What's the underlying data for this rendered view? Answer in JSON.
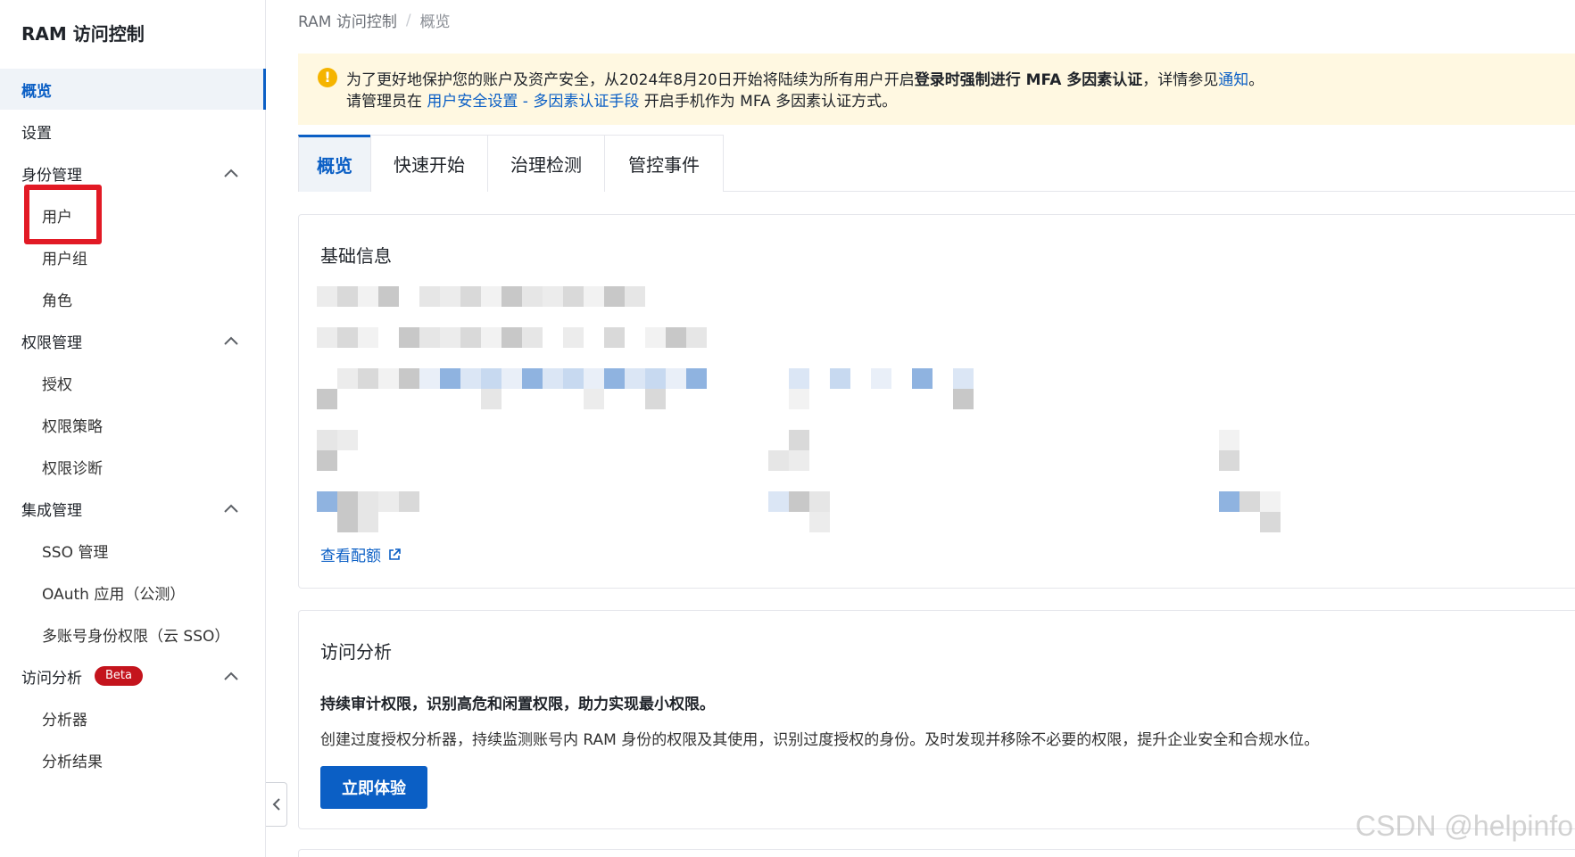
{
  "sidebar": {
    "title": "RAM 访问控制",
    "items": [
      {
        "label": "概览"
      },
      {
        "label": "设置"
      },
      {
        "label": "身份管理"
      },
      {
        "label": "用户"
      },
      {
        "label": "用户组"
      },
      {
        "label": "角色"
      },
      {
        "label": "权限管理"
      },
      {
        "label": "授权"
      },
      {
        "label": "权限策略"
      },
      {
        "label": "权限诊断"
      },
      {
        "label": "集成管理"
      },
      {
        "label": "SSO 管理"
      },
      {
        "label": "OAuth 应用（公测）"
      },
      {
        "label": "多账号身份权限（云 SSO）"
      },
      {
        "label": "访问分析"
      },
      {
        "label": "分析器"
      },
      {
        "label": "分析结果"
      }
    ],
    "beta_badge": "Beta"
  },
  "breadcrumb": {
    "root": "RAM 访问控制",
    "separator": "/",
    "current": "概览"
  },
  "notice": {
    "line1_pre": "为了更好地保护您的账户及资产安全，从2024年8月20日开始将陆续为所有用户开启",
    "line1_bold": "登录时强制进行 MFA 多因素认证",
    "line1_mid": "，详情参见",
    "line1_link": "通知",
    "line1_end": "。",
    "line2_pre": "请管理员在 ",
    "line2_link": "用户安全设置 - 多因素认证手段",
    "line2_end": " 开启手机作为 MFA 多因素认证方式。"
  },
  "tabs": [
    {
      "label": "概览"
    },
    {
      "label": "快速开始"
    },
    {
      "label": "治理检测"
    },
    {
      "label": "管控事件"
    }
  ],
  "basic_info": {
    "title": "基础信息",
    "view_quota": "查看配额"
  },
  "access_analysis": {
    "title": "访问分析",
    "heading": "持续审计权限，识别高危和闲置权限，助力实现最小权限。",
    "description": "创建过度授权分析器，持续监测账号内 RAM 身份的权限及其使用，识别过度授权的身份。及时发现并移除不必要的权限，提升企业安全和合规水位。",
    "button": "立即体验"
  },
  "watermark": "CSDN @helpinfo",
  "colors": {
    "accent": "#0b5fc5",
    "highlight": "#e21a25",
    "notice_bg": "#fff8e1",
    "beta": "#c4141d"
  }
}
